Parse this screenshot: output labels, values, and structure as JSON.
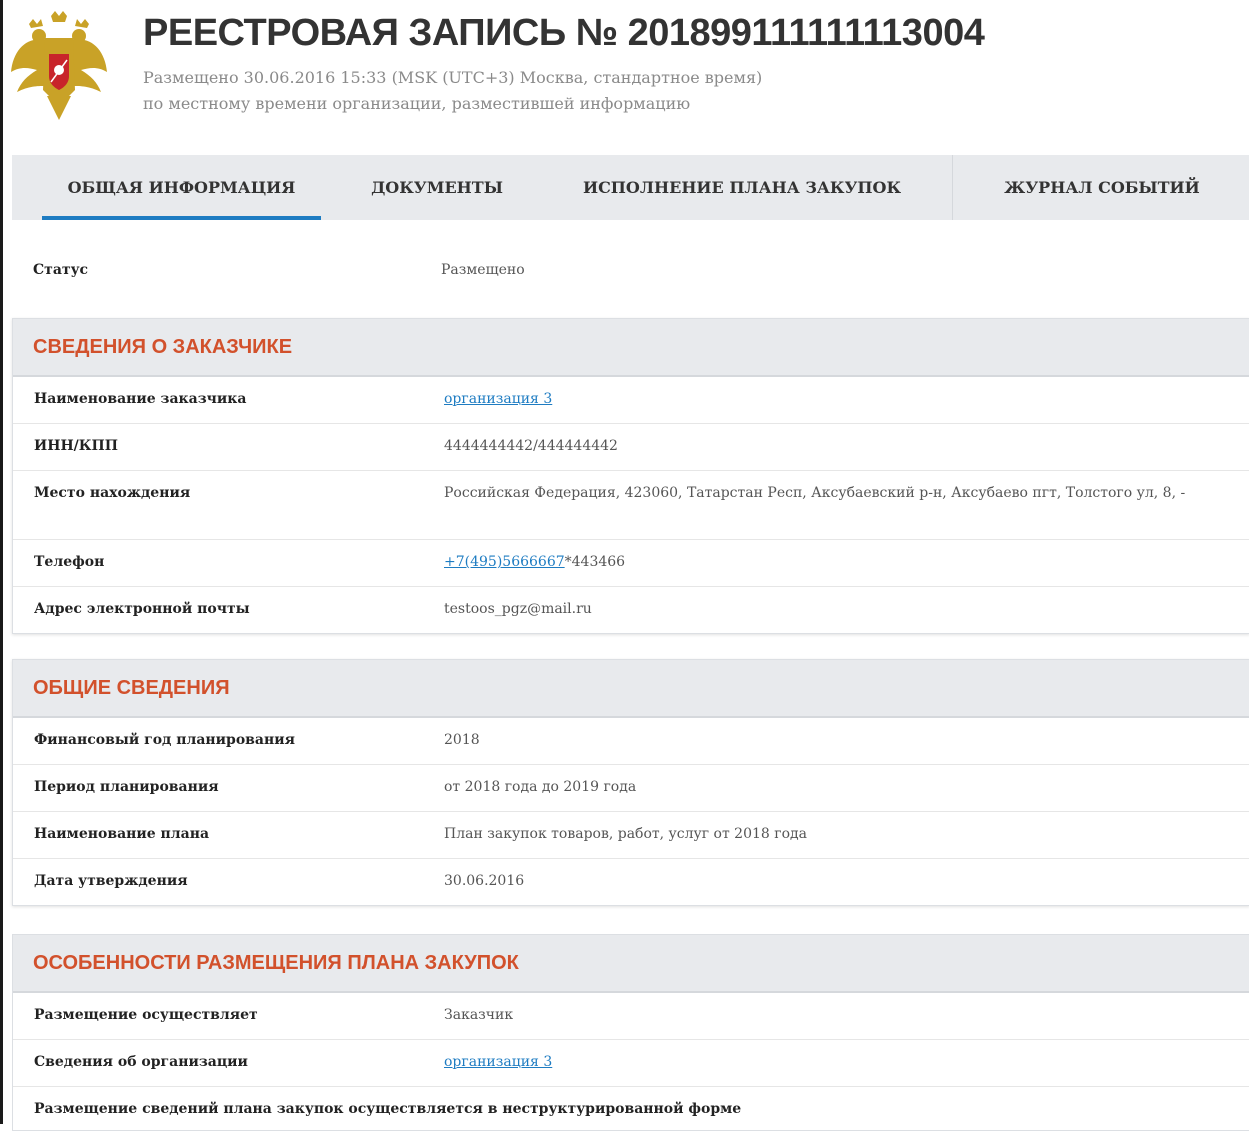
{
  "header": {
    "title": "РЕЕСТРОВАЯ ЗАПИСЬ № 201899111111113004",
    "subtitle_line1": "Размещено 30.06.2016 15:33 (MSK (UTC+3) Москва, стандартное время)",
    "subtitle_line2": "по местному времени организации, разместившей информацию",
    "emblem_icon": "coat-of-arms-russia-icon"
  },
  "tabs": [
    {
      "label": "ОБЩАЯ ИНФОРМАЦИЯ",
      "active": true
    },
    {
      "label": "ДОКУМЕНТЫ",
      "active": false
    },
    {
      "label": "ИСПОЛНЕНИЕ ПЛАНА ЗАКУПОК",
      "active": false
    },
    {
      "label": "ЖУРНАЛ СОБЫТИЙ",
      "active": false
    }
  ],
  "status": {
    "label": "Статус",
    "value": "Размещено"
  },
  "customer": {
    "title": "СВЕДЕНИЯ О ЗАКАЗЧИКЕ",
    "rows": [
      {
        "label": "Наименование заказчика",
        "value": "организация 3"
      },
      {
        "label": "ИНН/КПП",
        "value": "4444444442/444444442"
      },
      {
        "label": "Место нахождения",
        "value": "Российская Федерация, 423060, Татарстан Респ, Аксубаевский р-н, Аксубаево пгт, Толстого ул, 8, -"
      },
      {
        "label": "Телефон",
        "value_link": "+7(495)5666667",
        "value_ext": "*443466"
      },
      {
        "label": "Адрес электронной почты",
        "value": "testoos_pgz@mail.ru"
      }
    ]
  },
  "general": {
    "title": "ОБЩИЕ СВЕДЕНИЯ",
    "rows": [
      {
        "label": "Финансовый год планирования",
        "value": "2018"
      },
      {
        "label": "Период планирования",
        "value": "от 2018 года до 2019 года"
      },
      {
        "label": "Наименование плана",
        "value": "План закупок товаров, работ, услуг от 2018 года"
      },
      {
        "label": "Дата утверждения",
        "value": "30.06.2016"
      }
    ]
  },
  "placement": {
    "title": "ОСОБЕННОСТИ РАЗМЕЩЕНИЯ ПЛАНА ЗАКУПОК",
    "rows": [
      {
        "label": "Размещение осуществляет",
        "value": "Заказчик"
      },
      {
        "label": "Сведения об организации",
        "value": "организация 3"
      },
      {
        "label": "Размещение сведений плана закупок осуществляется в неструктурированной форме"
      }
    ]
  },
  "colors": {
    "accent": "#1e7cc2",
    "section_title": "#d2512c",
    "header_bg": "#e8eaed"
  }
}
